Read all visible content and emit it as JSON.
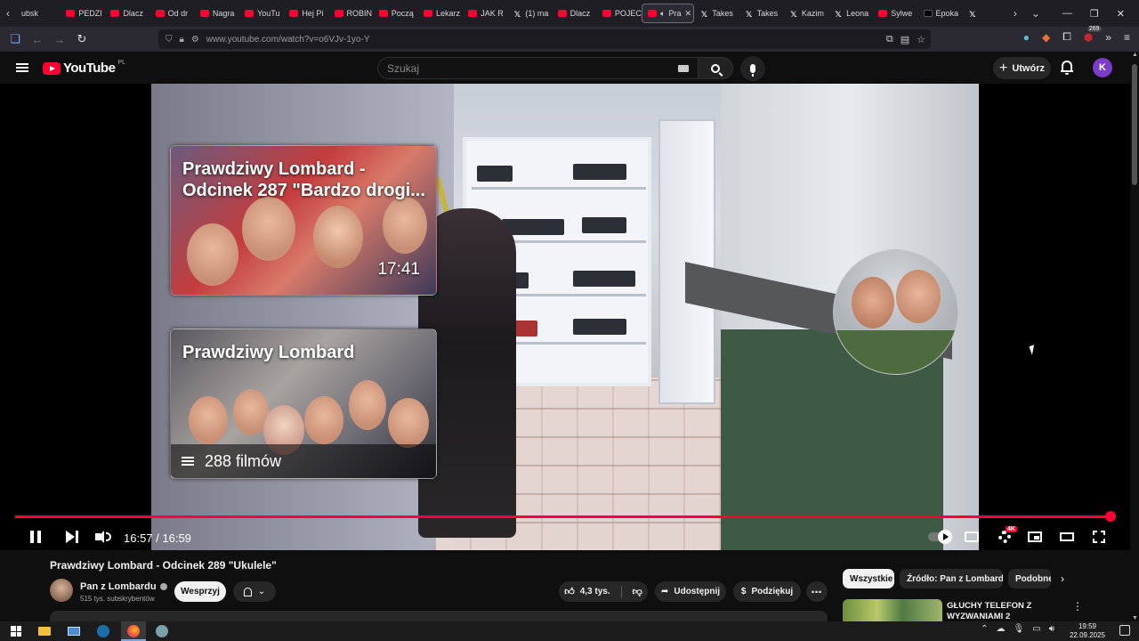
{
  "browser": {
    "tabs": [
      {
        "label": "ubsk",
        "icon": "none"
      },
      {
        "label": "PEDZI",
        "icon": "youtube-icon"
      },
      {
        "label": "Dlacz",
        "icon": "youtube-icon"
      },
      {
        "label": "Od dr",
        "icon": "youtube-icon"
      },
      {
        "label": "Nagra",
        "icon": "youtube-icon"
      },
      {
        "label": "YouTu",
        "icon": "youtube-icon"
      },
      {
        "label": "Hej Pi",
        "icon": "youtube-icon"
      },
      {
        "label": "ROBIN",
        "icon": "youtube-icon"
      },
      {
        "label": "Począ",
        "icon": "youtube-icon"
      },
      {
        "label": "Lekarz",
        "icon": "youtube-icon"
      },
      {
        "label": "JAK R",
        "icon": "youtube-icon"
      },
      {
        "label": "(1) ma",
        "icon": "x-icon"
      },
      {
        "label": "Dlacz",
        "icon": "youtube-icon"
      },
      {
        "label": "POJEC",
        "icon": "youtube-icon"
      },
      {
        "label": "Pra",
        "icon": "youtube-icon",
        "active": true
      },
      {
        "label": "Takes",
        "icon": "x-icon"
      },
      {
        "label": "Takes",
        "icon": "x-icon"
      },
      {
        "label": "Kazim",
        "icon": "x-icon"
      },
      {
        "label": "Leona",
        "icon": "x-icon"
      },
      {
        "label": "Sylwe",
        "icon": "youtube-icon"
      },
      {
        "label": "Epoka",
        "icon": "tiktok-icon"
      },
      {
        "label": "",
        "icon": "x-icon"
      }
    ],
    "url": "www.youtube.com/watch?v=o6VJv-1yo-Y",
    "extension_badge": "269"
  },
  "youtube": {
    "logo_text": "YouTube",
    "region": "PL",
    "search_placeholder": "Szukaj",
    "create_label": "Utwórz",
    "avatar_letter": "K"
  },
  "player": {
    "current_time": "16:57",
    "duration": "16:59",
    "time_display": "16:57 / 16:59",
    "progress_fraction": 0.998,
    "quality_badge": "4K",
    "end_cards": {
      "video": {
        "title": "Prawdziwy Lombard - Odcinek 287 \"Bardzo drogi...",
        "duration": "17:41"
      },
      "playlist": {
        "title": "Prawdziwy Lombard",
        "count": "288 filmów"
      }
    }
  },
  "video": {
    "title": "Prawdziwy Lombard - Odcinek 289 \"Ukulele\"",
    "channel_name": "Pan z Lombardu",
    "subscribers": "515 tys. subskrybentów",
    "support_label": "Wesprzyj",
    "likes": "4,3 tys.",
    "share_label": "Udostępnij",
    "thanks_label": "Podziękuj"
  },
  "sidebar": {
    "chips": [
      "Wszystkie",
      "Źródło: Pan z Lombardu",
      "Podobne"
    ],
    "recommended": [
      {
        "title": "GŁUCHY TELEFON Z WYZWANIAMI 2"
      }
    ]
  },
  "taskbar": {
    "time": "19:59",
    "date": "22.09.2025"
  }
}
